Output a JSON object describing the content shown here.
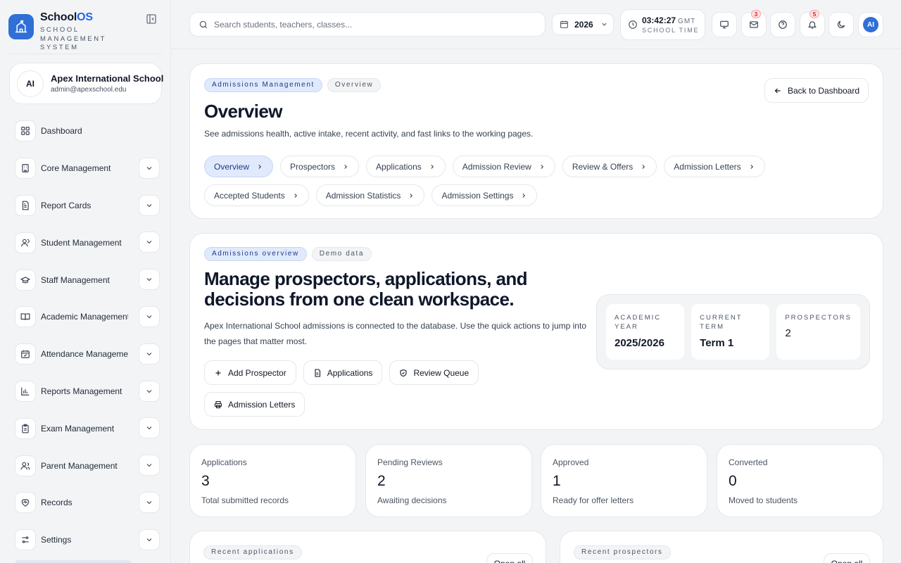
{
  "brand": {
    "name_main": "School",
    "name_accent": "OS",
    "subtitle": "SCHOOL MANAGEMENT SYSTEM"
  },
  "school": {
    "initials": "AI",
    "name": "Apex International School",
    "email": "admin@apexschool.edu"
  },
  "nav": {
    "items": [
      {
        "label": "Dashboard",
        "icon": "grid-icon"
      },
      {
        "label": "Core Management",
        "icon": "building-icon"
      },
      {
        "label": "Report Cards",
        "icon": "report-card-icon"
      },
      {
        "label": "Student Management",
        "icon": "user-icon"
      },
      {
        "label": "Staff Management",
        "icon": "graduation-cap-icon"
      },
      {
        "label": "Academic Management",
        "icon": "book-icon"
      },
      {
        "label": "Attendance Management",
        "icon": "calendar-check-icon"
      },
      {
        "label": "Reports Management",
        "icon": "bar-chart-icon"
      },
      {
        "label": "Exam Management",
        "icon": "clipboard-icon"
      },
      {
        "label": "Parent Management",
        "icon": "users-icon"
      },
      {
        "label": "Records",
        "icon": "records-icon"
      },
      {
        "label": "Settings",
        "icon": "sliders-icon"
      }
    ]
  },
  "topbar": {
    "search_placeholder": "Search students, teachers, classes...",
    "year": "2026",
    "time": "03:42:27",
    "timezone": "GMT",
    "time_label": "SCHOOL TIME",
    "mail_count": "3",
    "notification_count": "5",
    "user_initials": "AI"
  },
  "header": {
    "pill_section": "Admissions Management",
    "pill_page": "Overview",
    "title": "Overview",
    "description": "See admissions health, active intake, recent activity, and fast links to the working pages.",
    "back_label": "Back to Dashboard",
    "tabs": [
      "Overview",
      "Prospectors",
      "Applications",
      "Admission Review",
      "Review & Offers",
      "Admission Letters",
      "Accepted Students",
      "Admission Statistics",
      "Admission Settings"
    ]
  },
  "hero": {
    "pill_section": "Admissions overview",
    "pill_demo": "Demo data",
    "title": "Manage prospectors, applications, and decisions from one clean workspace.",
    "description": "Apex International School admissions is connected to the database. Use the quick actions to jump into the pages that matter most.",
    "actions": {
      "add_prospector": "Add Prospector",
      "applications": "Applications",
      "review_queue": "Review Queue",
      "admission_letters": "Admission Letters"
    },
    "stats": {
      "academic_year_label": "ACADEMIC YEAR",
      "academic_year_value": "2025/2026",
      "current_term_label": "CURRENT TERM",
      "current_term_value": "Term 1",
      "prospectors_label": "PROSPECTORS",
      "prospectors_value": "2"
    }
  },
  "metrics": [
    {
      "label": "Applications",
      "value": "3",
      "sub": "Total submitted records"
    },
    {
      "label": "Pending Reviews",
      "value": "2",
      "sub": "Awaiting decisions"
    },
    {
      "label": "Approved",
      "value": "1",
      "sub": "Ready for offer letters"
    },
    {
      "label": "Converted",
      "value": "0",
      "sub": "Moved to students"
    }
  ],
  "lists": {
    "recent_applications": "Recent applications",
    "recent_prospectors": "Recent prospectors",
    "open_all": "Open all"
  },
  "colors": {
    "accent": "#2f6fd6",
    "pill_blue_bg": "#e0eafc",
    "badge_red": "#dc2626"
  }
}
